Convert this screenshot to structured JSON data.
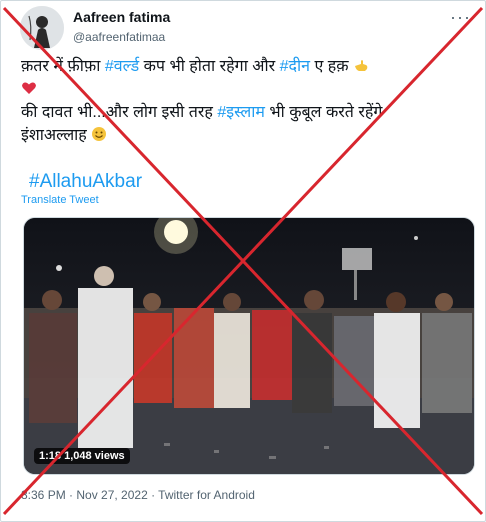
{
  "user": {
    "display_name": "Aafreen fatima",
    "handle": "@aafreenfatimaa"
  },
  "tweet": {
    "line1": {
      "t1": "क़तर में फ़ीफ़ा ",
      "tag1": "#वर्ल्ड",
      "t2": " कप भी होता रहेगा और ",
      "tag2": "#दीन",
      "t3": " ए हक़"
    },
    "line2": {
      "t1": "की दावत भी...और लोग इसी तरह ",
      "tag1": "#इस्लाम",
      "t2": " भी कुबूल करते रहेंगे"
    },
    "line3": {
      "t1": "इंशाअल्लाह"
    },
    "hashtag": "#AllahuAkbar",
    "translate_label": "Translate Tweet"
  },
  "video": {
    "time": "1:18",
    "views": "1,048 views"
  },
  "meta": {
    "timestamp": "8:36 PM · Nov 27, 2022 · Twitter for Android"
  },
  "icons": {
    "more": "more-options-icon",
    "point_left": "pointing-hand-emoji-icon",
    "heart": "red-heart-emoji-icon",
    "smile": "smiling-face-emoji-icon"
  },
  "colors": {
    "link": "#1d9bf0",
    "cross": "#d8262e",
    "text": "#0f1419",
    "muted": "#536471"
  }
}
